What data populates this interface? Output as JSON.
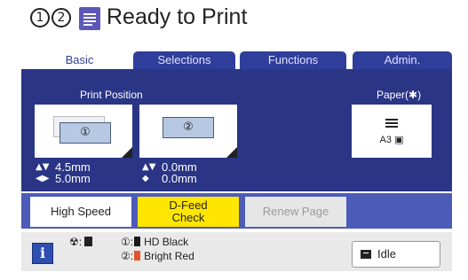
{
  "header": {
    "job_number_1": "1",
    "job_number_2": "2",
    "title": "Ready to Print",
    "icon": "document-icon"
  },
  "tabs": [
    {
      "label": "Basic",
      "active": true
    },
    {
      "label": "Selections",
      "active": false
    },
    {
      "label": "Functions",
      "active": false
    },
    {
      "label": "Admin.",
      "active": false
    }
  ],
  "panel": {
    "print_position_label": "Print Position",
    "paper_label": "Paper(✱)",
    "drum1": {
      "number": "①",
      "vertical": "4.5mm",
      "horizontal": "5.0mm"
    },
    "drum2": {
      "number": "②",
      "vertical": "0.0mm",
      "horizontal": "0.0mm"
    },
    "paper_size": "A3"
  },
  "actions": {
    "high_speed": "High Speed",
    "dfeed_line1": "D-Feed",
    "dfeed_line2": "Check",
    "renew_page": "Renew Page"
  },
  "status": {
    "drum_label": "①:",
    "drum2_label": "②:",
    "ink1": "HD Black",
    "ink2": "Bright Red",
    "ink1_color": "#1a1a1a",
    "ink2_color": "#e4532a",
    "state": "Idle"
  },
  "colors": {
    "panel": "#2a3586",
    "tab": "#2f3e9a",
    "action_bar": "#4d5bb8",
    "dfeed": "#ffe600"
  }
}
